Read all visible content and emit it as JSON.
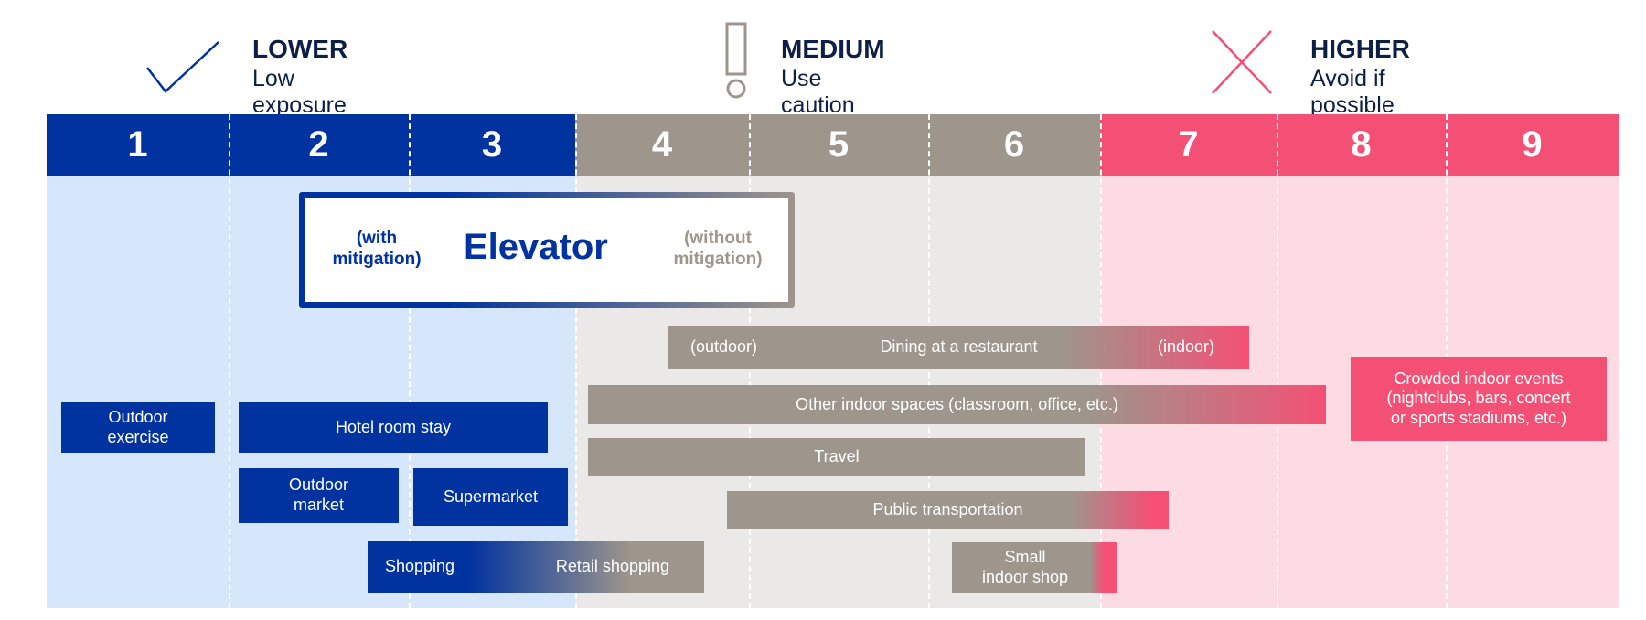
{
  "legend": [
    {
      "title": "LOWER",
      "subtitle": "Low exposure",
      "icon": "check-icon",
      "color": "#0033a0"
    },
    {
      "title": "MEDIUM",
      "subtitle": "Use caution",
      "icon": "exclamation-icon",
      "color": "#9e958c"
    },
    {
      "title": "HIGHER",
      "subtitle": "Avoid if possible",
      "icon": "x-icon",
      "color": "#f45075"
    }
  ],
  "scale": [
    "1",
    "2",
    "3",
    "4",
    "5",
    "6",
    "7",
    "8",
    "9"
  ],
  "colors": {
    "lower": "#0033a0",
    "medium": "#9e958c",
    "higher": "#f45075",
    "lower_bg": "#d6e6fb",
    "medium_bg": "#ebe9e7",
    "higher_bg": "#fddbe2"
  },
  "elevator": {
    "with": "(with\nmitigation)",
    "title": "Elevator",
    "without": "(without\nmitigation)"
  },
  "activities": {
    "dining": {
      "left": "(outdoor)",
      "center": "Dining at a restaurant",
      "right": "(indoor)"
    },
    "other_indoor": "Other indoor spaces (classroom, office, etc.)",
    "travel": "Travel",
    "public_transport": "Public transportation",
    "small_shop": "Small\nindoor shop",
    "crowded": "Crowded indoor events\n(nightclubs, bars, concert\nor sports stadiums, etc.)",
    "outdoor_exercise": "Outdoor\nexercise",
    "hotel": "Hotel room stay",
    "outdoor_market": "Outdoor\nmarket",
    "supermarket": "Supermarket",
    "shopping": {
      "left": "Shopping",
      "right": "Retail shopping"
    }
  }
}
